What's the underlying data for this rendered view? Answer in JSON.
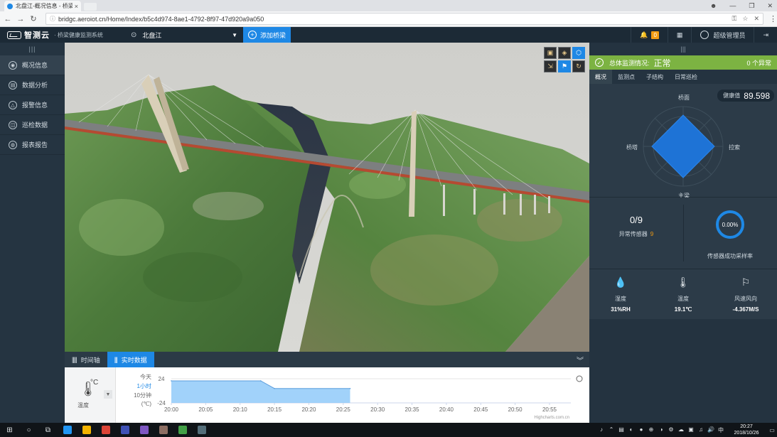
{
  "browser": {
    "tab_title": "北盘江-概况信息 - 桥梁健",
    "tab_close": "×",
    "url": "bridgc.aeroiot.cn/Home/Index/b5c4d974-8ae1-4792-8f97-47d920a9a050",
    "lock": "ⓘ",
    "back": "←",
    "forward": "→",
    "reload": "↻",
    "key_icon": "⚿",
    "star_icon": "☆",
    "ext_icon": "✕",
    "menu": "⋮",
    "win_user": "☻",
    "win_min": "—",
    "win_max": "❐",
    "win_close": "✕"
  },
  "header": {
    "logo_name": "智测云",
    "logo_sub": "· 桥梁健康监测系统",
    "location_pin": "⊙",
    "location": "北盘江",
    "location_caret": "▼",
    "add_bridge_plus": "+",
    "add_bridge_label": "添加桥梁",
    "bell": "🔔",
    "alert_count": "0",
    "grid_icon": "▦",
    "user_label": "超级管理员",
    "logout_icon": "⇥"
  },
  "sidebar": {
    "collapse": "|||",
    "items": [
      {
        "label": "概况信息",
        "icon": "◉"
      },
      {
        "label": "数据分析",
        "icon": "▤"
      },
      {
        "label": "报警信息",
        "icon": "△"
      },
      {
        "label": "巡检数据",
        "icon": "◫"
      },
      {
        "label": "报表报告",
        "icon": "◍"
      }
    ]
  },
  "view_tools": [
    "▣",
    "◈",
    "⬡",
    "⇲",
    "⚑",
    "↻"
  ],
  "bottom": {
    "timeline_icon": "|||||",
    "timeline_label": "时间轴",
    "realtime_icon": "|||",
    "realtime_label": "实时数据",
    "collapse": "︾"
  },
  "sensor": {
    "thermo_icon": "🌡",
    "unit": "°C",
    "name": "温度",
    "dropdown": "▼",
    "ranges": [
      "今天",
      "1小时",
      "10分钟"
    ],
    "unit_label": "(℃)"
  },
  "chart_data": {
    "type": "area",
    "title": "",
    "x_ticks": [
      "20:00",
      "20:05",
      "20:10",
      "20:15",
      "20:20",
      "20:25",
      "20:30",
      "20:35",
      "20:40",
      "20:45",
      "20:50",
      "20:55"
    ],
    "y_ticks": [
      "24",
      "-24"
    ],
    "ylim": [
      -24,
      24
    ],
    "credit": "Highcharts.com.cn",
    "series": [
      {
        "x": [
          "20:00",
          "20:13",
          "20:15",
          "20:26"
        ],
        "values": [
          19.8,
          19.8,
          4.6,
          4.6
        ],
        "color": "#90caf9"
      }
    ]
  },
  "right": {
    "collapse": "|||",
    "status_icon": "✓",
    "status_label": "总体监测情况:",
    "status_value": "正常",
    "abnormal_count": "0 个异常",
    "tabs": [
      "概况",
      "监测点",
      "子结构",
      "日常巡检"
    ],
    "health_label": "健康值",
    "health_value": "89.598",
    "radar_labels": {
      "top": "桥面",
      "left": "桥塔",
      "right": "拉索",
      "bottom": "主梁"
    },
    "ratio": "0/9",
    "ratio_label": "异常传感器",
    "ratio_num": "9",
    "ring_value": "0.00%",
    "ring_label": "传感器成功采样率",
    "env": [
      {
        "icon": "💧",
        "name": "湿度",
        "value": "31%RH"
      },
      {
        "icon": "🌡",
        "name": "温度",
        "value": "19.1℃"
      },
      {
        "icon": "⚐",
        "name": "风速风向",
        "value": "-4.367M/S"
      }
    ]
  },
  "taskbar": {
    "icons": [
      "⊞",
      "○",
      "⧉"
    ],
    "apps": [
      "#2196f3",
      "#f4b400",
      "#db4437",
      "#3f51b5",
      "#7e57c2",
      "#8d6e63",
      "#43a047",
      "#546e7a"
    ],
    "tray": [
      "♪",
      "⌃",
      "▤",
      "◐",
      "●",
      "⊕",
      "◑",
      "⚙",
      "☁",
      "▣",
      "♫",
      "🔊",
      "中"
    ],
    "time": "20:27",
    "date": "2018/10/26",
    "notify": "▭"
  }
}
